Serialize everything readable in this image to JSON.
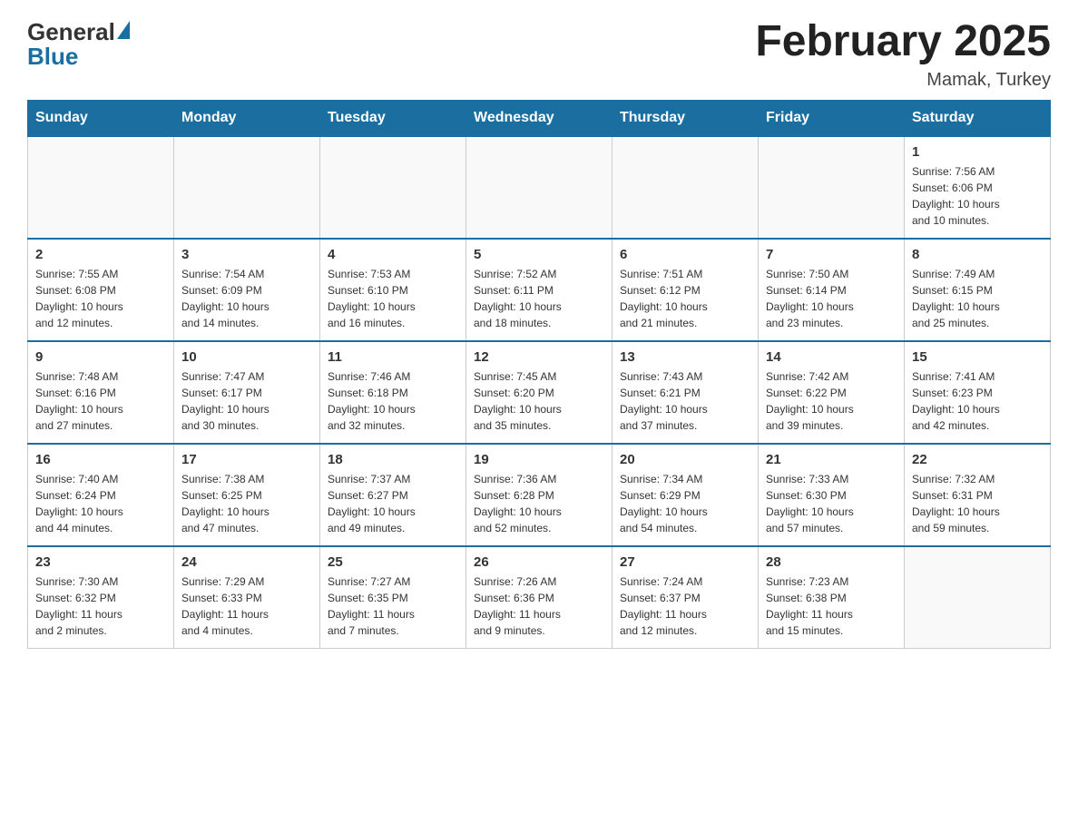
{
  "logo": {
    "general": "General",
    "blue": "Blue"
  },
  "header": {
    "title": "February 2025",
    "subtitle": "Mamak, Turkey"
  },
  "weekdays": [
    "Sunday",
    "Monday",
    "Tuesday",
    "Wednesday",
    "Thursday",
    "Friday",
    "Saturday"
  ],
  "weeks": [
    [
      {
        "day": "",
        "detail": ""
      },
      {
        "day": "",
        "detail": ""
      },
      {
        "day": "",
        "detail": ""
      },
      {
        "day": "",
        "detail": ""
      },
      {
        "day": "",
        "detail": ""
      },
      {
        "day": "",
        "detail": ""
      },
      {
        "day": "1",
        "detail": "Sunrise: 7:56 AM\nSunset: 6:06 PM\nDaylight: 10 hours\nand 10 minutes."
      }
    ],
    [
      {
        "day": "2",
        "detail": "Sunrise: 7:55 AM\nSunset: 6:08 PM\nDaylight: 10 hours\nand 12 minutes."
      },
      {
        "day": "3",
        "detail": "Sunrise: 7:54 AM\nSunset: 6:09 PM\nDaylight: 10 hours\nand 14 minutes."
      },
      {
        "day": "4",
        "detail": "Sunrise: 7:53 AM\nSunset: 6:10 PM\nDaylight: 10 hours\nand 16 minutes."
      },
      {
        "day": "5",
        "detail": "Sunrise: 7:52 AM\nSunset: 6:11 PM\nDaylight: 10 hours\nand 18 minutes."
      },
      {
        "day": "6",
        "detail": "Sunrise: 7:51 AM\nSunset: 6:12 PM\nDaylight: 10 hours\nand 21 minutes."
      },
      {
        "day": "7",
        "detail": "Sunrise: 7:50 AM\nSunset: 6:14 PM\nDaylight: 10 hours\nand 23 minutes."
      },
      {
        "day": "8",
        "detail": "Sunrise: 7:49 AM\nSunset: 6:15 PM\nDaylight: 10 hours\nand 25 minutes."
      }
    ],
    [
      {
        "day": "9",
        "detail": "Sunrise: 7:48 AM\nSunset: 6:16 PM\nDaylight: 10 hours\nand 27 minutes."
      },
      {
        "day": "10",
        "detail": "Sunrise: 7:47 AM\nSunset: 6:17 PM\nDaylight: 10 hours\nand 30 minutes."
      },
      {
        "day": "11",
        "detail": "Sunrise: 7:46 AM\nSunset: 6:18 PM\nDaylight: 10 hours\nand 32 minutes."
      },
      {
        "day": "12",
        "detail": "Sunrise: 7:45 AM\nSunset: 6:20 PM\nDaylight: 10 hours\nand 35 minutes."
      },
      {
        "day": "13",
        "detail": "Sunrise: 7:43 AM\nSunset: 6:21 PM\nDaylight: 10 hours\nand 37 minutes."
      },
      {
        "day": "14",
        "detail": "Sunrise: 7:42 AM\nSunset: 6:22 PM\nDaylight: 10 hours\nand 39 minutes."
      },
      {
        "day": "15",
        "detail": "Sunrise: 7:41 AM\nSunset: 6:23 PM\nDaylight: 10 hours\nand 42 minutes."
      }
    ],
    [
      {
        "day": "16",
        "detail": "Sunrise: 7:40 AM\nSunset: 6:24 PM\nDaylight: 10 hours\nand 44 minutes."
      },
      {
        "day": "17",
        "detail": "Sunrise: 7:38 AM\nSunset: 6:25 PM\nDaylight: 10 hours\nand 47 minutes."
      },
      {
        "day": "18",
        "detail": "Sunrise: 7:37 AM\nSunset: 6:27 PM\nDaylight: 10 hours\nand 49 minutes."
      },
      {
        "day": "19",
        "detail": "Sunrise: 7:36 AM\nSunset: 6:28 PM\nDaylight: 10 hours\nand 52 minutes."
      },
      {
        "day": "20",
        "detail": "Sunrise: 7:34 AM\nSunset: 6:29 PM\nDaylight: 10 hours\nand 54 minutes."
      },
      {
        "day": "21",
        "detail": "Sunrise: 7:33 AM\nSunset: 6:30 PM\nDaylight: 10 hours\nand 57 minutes."
      },
      {
        "day": "22",
        "detail": "Sunrise: 7:32 AM\nSunset: 6:31 PM\nDaylight: 10 hours\nand 59 minutes."
      }
    ],
    [
      {
        "day": "23",
        "detail": "Sunrise: 7:30 AM\nSunset: 6:32 PM\nDaylight: 11 hours\nand 2 minutes."
      },
      {
        "day": "24",
        "detail": "Sunrise: 7:29 AM\nSunset: 6:33 PM\nDaylight: 11 hours\nand 4 minutes."
      },
      {
        "day": "25",
        "detail": "Sunrise: 7:27 AM\nSunset: 6:35 PM\nDaylight: 11 hours\nand 7 minutes."
      },
      {
        "day": "26",
        "detail": "Sunrise: 7:26 AM\nSunset: 6:36 PM\nDaylight: 11 hours\nand 9 minutes."
      },
      {
        "day": "27",
        "detail": "Sunrise: 7:24 AM\nSunset: 6:37 PM\nDaylight: 11 hours\nand 12 minutes."
      },
      {
        "day": "28",
        "detail": "Sunrise: 7:23 AM\nSunset: 6:38 PM\nDaylight: 11 hours\nand 15 minutes."
      },
      {
        "day": "",
        "detail": ""
      }
    ]
  ]
}
